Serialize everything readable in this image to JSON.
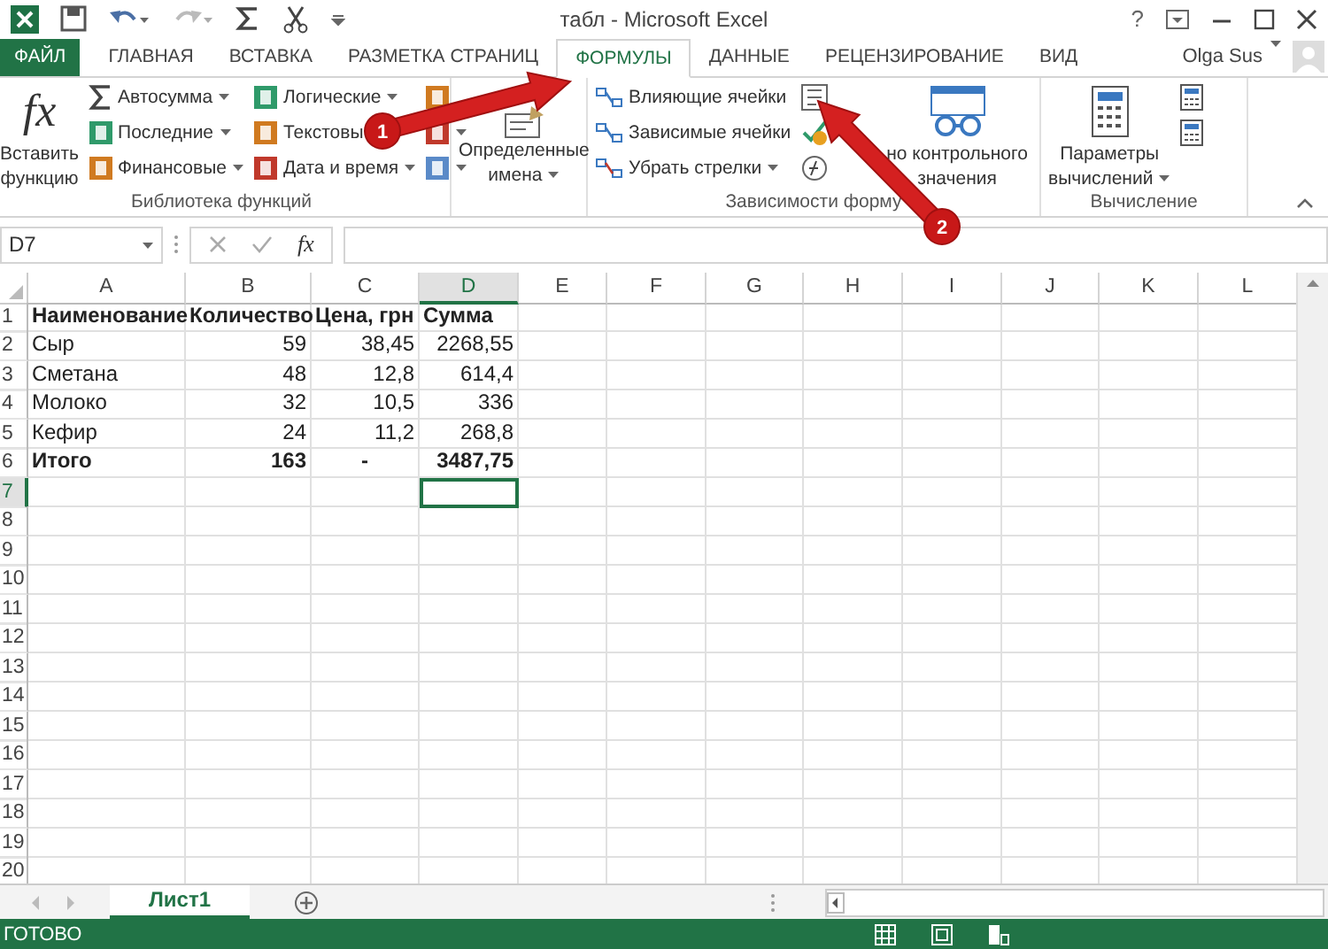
{
  "title_bar": {
    "title": "табл - Microsoft Excel",
    "help": "?"
  },
  "ribbon_tabs": [
    {
      "label": "ФАЙЛ",
      "kind": "file",
      "selected": false
    },
    {
      "label": "ГЛАВНАЯ",
      "kind": "tab",
      "selected": false
    },
    {
      "label": "ВСТАВКА",
      "kind": "tab",
      "selected": false
    },
    {
      "label": "РАЗМЕТКА СТРАНИЦ",
      "kind": "tab",
      "selected": false
    },
    {
      "label": "ФОРМУЛЫ",
      "kind": "tab",
      "selected": true
    },
    {
      "label": "ДАННЫЕ",
      "kind": "tab",
      "selected": false
    },
    {
      "label": "РЕЦЕНЗИРОВАНИЕ",
      "kind": "tab",
      "selected": false
    },
    {
      "label": "ВИД",
      "kind": "tab",
      "selected": false
    }
  ],
  "account": {
    "user": "Olga Sus"
  },
  "ribbon_groups": [
    {
      "label": "Библиотека функций",
      "columns": [
        [
          {
            "kind": "large",
            "symbol": "fx",
            "lines": [
              "Вставить",
              "функцию"
            ],
            "dropdown": false
          }
        ],
        [
          {
            "kind": "small",
            "label": "Автосумма",
            "dropdown": true
          },
          {
            "kind": "small",
            "label": "Последние",
            "dropdown": true
          },
          {
            "kind": "small",
            "label": "Финансовые",
            "dropdown": true
          }
        ],
        [
          {
            "kind": "small",
            "label": "Логические",
            "dropdown": true
          },
          {
            "kind": "small",
            "label": "Текстовы",
            "dropdown": false
          },
          {
            "kind": "small",
            "label": "Дата и время",
            "dropdown": true
          }
        ],
        [
          {
            "kind": "icon"
          },
          {
            "kind": "icon",
            "dropdown": true
          },
          {
            "kind": "icon",
            "dropdown": true
          }
        ]
      ]
    },
    {
      "columns": [
        [
          {
            "kind": "large",
            "lines": [
              "Определенные",
              "имена"
            ],
            "dropdown": true
          }
        ]
      ]
    },
    {
      "label": "Зависимости форму",
      "columns": [
        [
          {
            "kind": "small",
            "label": "Влияющие ячейки",
            "dropdown": false
          },
          {
            "kind": "small",
            "label": "Зависимые ячейки",
            "dropdown": false
          },
          {
            "kind": "small",
            "label": "Убрать стрелки",
            "dropdown": true
          }
        ],
        [
          {
            "kind": "icon",
            "dropdown": false
          },
          {
            "kind": "icon",
            "dropdown": false
          },
          {
            "kind": "icon",
            "dropdown": false
          }
        ],
        [
          {
            "kind": "large",
            "lines": [
              "но контрольного",
              "значения"
            ],
            "dropdown": false
          }
        ]
      ]
    },
    {
      "label": "Вычисление",
      "columns": [
        [
          {
            "kind": "large",
            "lines": [
              "Параметры",
              "вычислений"
            ],
            "dropdown": true
          }
        ],
        [
          {
            "kind": "icon",
            "dropdown": false
          },
          {
            "kind": "icon",
            "dropdown": false
          }
        ]
      ]
    }
  ],
  "formula_bar": {
    "name_box": "D7",
    "function_symbol": "fx"
  },
  "sheet": {
    "columns": [
      {
        "label": "A",
        "selected": false
      },
      {
        "label": "B",
        "selected": false
      },
      {
        "label": "C",
        "selected": false
      },
      {
        "label": "D",
        "selected": true
      },
      {
        "label": "E",
        "selected": false
      },
      {
        "label": "F",
        "selected": false
      },
      {
        "label": "G",
        "selected": false
      },
      {
        "label": "H",
        "selected": false
      },
      {
        "label": "I",
        "selected": false
      },
      {
        "label": "J",
        "selected": false
      },
      {
        "label": "K",
        "selected": false
      },
      {
        "label": "L",
        "selected": false
      }
    ],
    "rows": [
      {
        "label": "1",
        "selected": false,
        "bold": true,
        "cells": [
          {
            "text": "Наименование",
            "kind": "text"
          },
          {
            "text": "Количество",
            "kind": "text"
          },
          {
            "text": "Цена, грн",
            "kind": "text"
          },
          {
            "text": "Сумма",
            "kind": "text"
          }
        ]
      },
      {
        "label": "2",
        "selected": false,
        "bold": false,
        "cells": [
          {
            "text": "Сыр",
            "kind": "text"
          },
          {
            "text": "59",
            "kind": "number"
          },
          {
            "text": "38,45",
            "kind": "number"
          },
          {
            "text": "2268,55",
            "kind": "number"
          }
        ]
      },
      {
        "label": "3",
        "selected": false,
        "bold": false,
        "cells": [
          {
            "text": "Сметана",
            "kind": "text"
          },
          {
            "text": "48",
            "kind": "number"
          },
          {
            "text": "12,8",
            "kind": "number"
          },
          {
            "text": "614,4",
            "kind": "number"
          }
        ]
      },
      {
        "label": "4",
        "selected": false,
        "bold": false,
        "cells": [
          {
            "text": "Молоко",
            "kind": "text"
          },
          {
            "text": "32",
            "kind": "number"
          },
          {
            "text": "10,5",
            "kind": "number"
          },
          {
            "text": "336",
            "kind": "number"
          }
        ]
      },
      {
        "label": "5",
        "selected": false,
        "bold": false,
        "cells": [
          {
            "text": "Кефир",
            "kind": "text"
          },
          {
            "text": "24",
            "kind": "number"
          },
          {
            "text": "11,2",
            "kind": "number"
          },
          {
            "text": "268,8",
            "kind": "number"
          }
        ]
      },
      {
        "label": "6",
        "selected": false,
        "bold": true,
        "cells": [
          {
            "text": "Итого",
            "kind": "text"
          },
          {
            "text": "163",
            "kind": "number"
          },
          {
            "text": "-",
            "kind": "dash"
          },
          {
            "text": "3487,75",
            "kind": "number"
          }
        ]
      },
      {
        "label": "7",
        "selected": true
      },
      {
        "label": "8",
        "selected": false
      },
      {
        "label": "9",
        "selected": false
      },
      {
        "label": "10",
        "selected": false
      },
      {
        "label": "11",
        "selected": false
      },
      {
        "label": "12",
        "selected": false
      },
      {
        "label": "13",
        "selected": false
      },
      {
        "label": "14",
        "selected": false
      },
      {
        "label": "15",
        "selected": false
      },
      {
        "label": "16",
        "selected": false
      },
      {
        "label": "17",
        "selected": false
      },
      {
        "label": "18",
        "selected": false
      },
      {
        "label": "19",
        "selected": false
      },
      {
        "label": "20",
        "selected": false
      }
    ]
  },
  "sheet_tabs": [
    {
      "label": "Лист1",
      "selected": true
    }
  ],
  "status_bar": {
    "text": "ГОТОВО"
  },
  "annotations": [
    {
      "label": "1"
    },
    {
      "label": "2"
    }
  ]
}
